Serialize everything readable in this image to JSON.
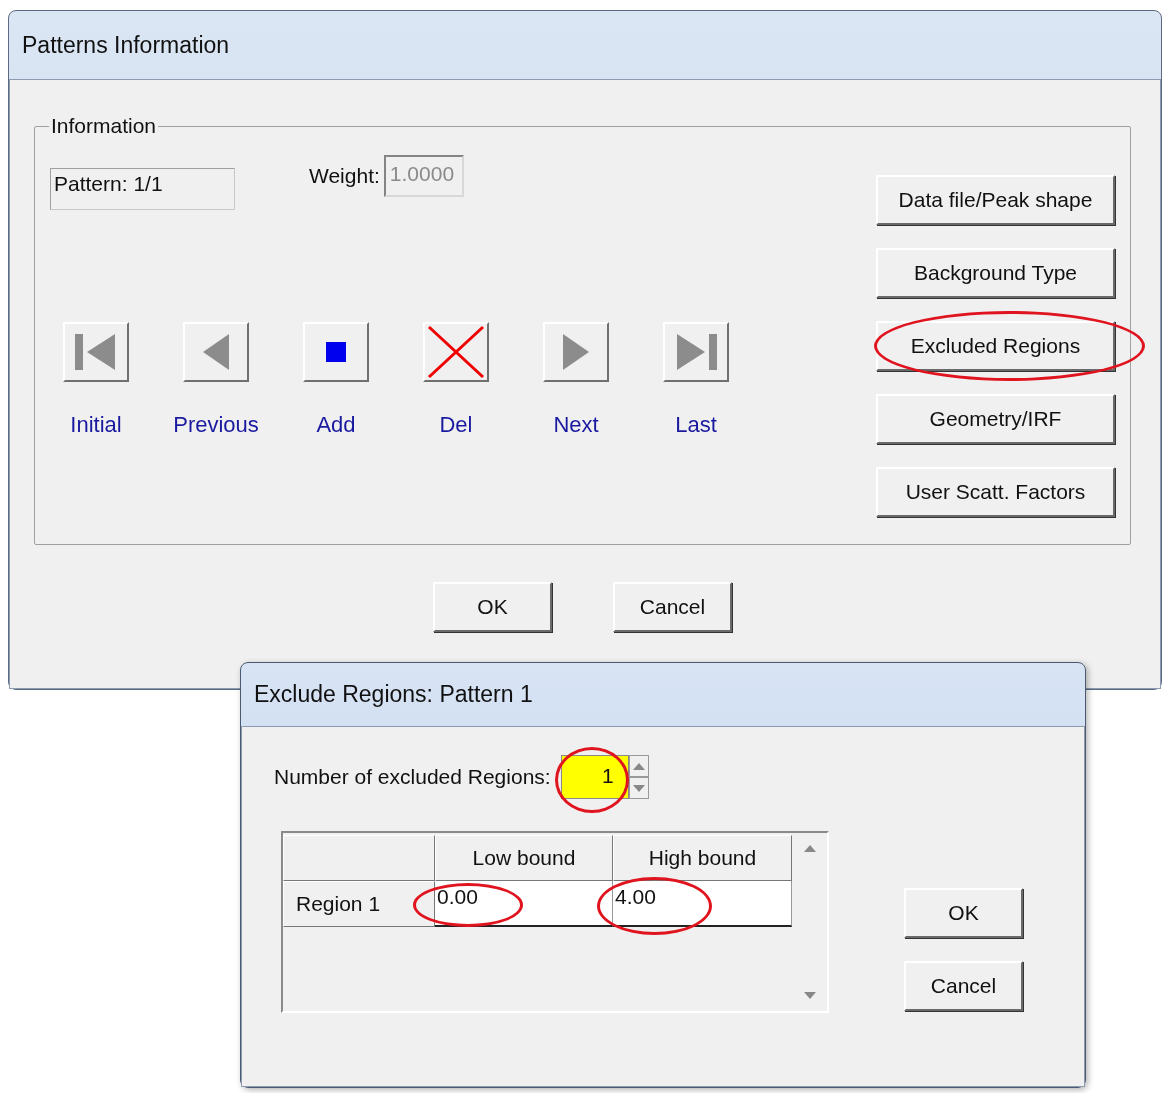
{
  "patterns_window": {
    "title": "Patterns Information",
    "group_title": "Information",
    "pattern_label": "Pattern: 1/1",
    "weight": {
      "label": "Weight:",
      "value": "1.0000",
      "disabled": true
    },
    "nav_buttons": [
      {
        "kind": "first",
        "label": "Initial"
      },
      {
        "kind": "previous",
        "label": "Previous"
      },
      {
        "kind": "add",
        "label": "Add"
      },
      {
        "kind": "delete",
        "label": "Del"
      },
      {
        "kind": "next",
        "label": "Next"
      },
      {
        "kind": "last",
        "label": "Last"
      }
    ],
    "side_buttons": [
      {
        "label": "Data file/Peak shape",
        "highlighted": false
      },
      {
        "label": "Background Type",
        "highlighted": false
      },
      {
        "label": "Excluded Regions",
        "highlighted": true
      },
      {
        "label": "Geometry/IRF",
        "highlighted": false
      },
      {
        "label": "User Scatt. Factors",
        "highlighted": false
      }
    ],
    "buttons": [
      "OK",
      "Cancel"
    ]
  },
  "exclude_window": {
    "title": "Exclude Regions: Pattern 1",
    "count": {
      "label": "Number of excluded Regions:",
      "value": "1",
      "highlighted": true
    },
    "table": {
      "columns": [
        "Low bound",
        "High bound"
      ],
      "rows": [
        {
          "label": "Region 1",
          "cells": [
            {
              "value": "0.00",
              "highlighted": true
            },
            {
              "value": "4.00",
              "highlighted": true
            }
          ]
        }
      ]
    },
    "buttons": [
      "OK",
      "Cancel"
    ]
  }
}
